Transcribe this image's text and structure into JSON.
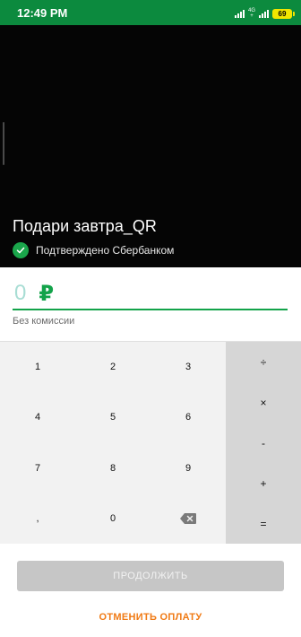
{
  "status_bar": {
    "time": "12:49 PM",
    "network_label_top": "4G",
    "network_label_bottom": "+",
    "battery": "69"
  },
  "header": {
    "merchant_name": "Подари завтра_QR",
    "verified_text": "Подтверждено Сбербанком",
    "verified_icon": "check-circle-icon",
    "accent_color": "#1aa64b"
  },
  "amount": {
    "value": "0",
    "currency": "₽",
    "commission_note": "Без комиссии"
  },
  "keypad": {
    "keys": [
      "1",
      "2",
      "3",
      "4",
      "5",
      "6",
      "7",
      "8",
      "9",
      ",",
      "0"
    ],
    "backspace_icon": "backspace-icon",
    "operators": [
      "÷",
      "×",
      "-",
      "+",
      "="
    ]
  },
  "actions": {
    "continue_label": "ПРОДОЛЖИТЬ",
    "cancel_label": "ОТМЕНИТЬ ОПЛАТУ",
    "cancel_color": "#f07a14"
  }
}
